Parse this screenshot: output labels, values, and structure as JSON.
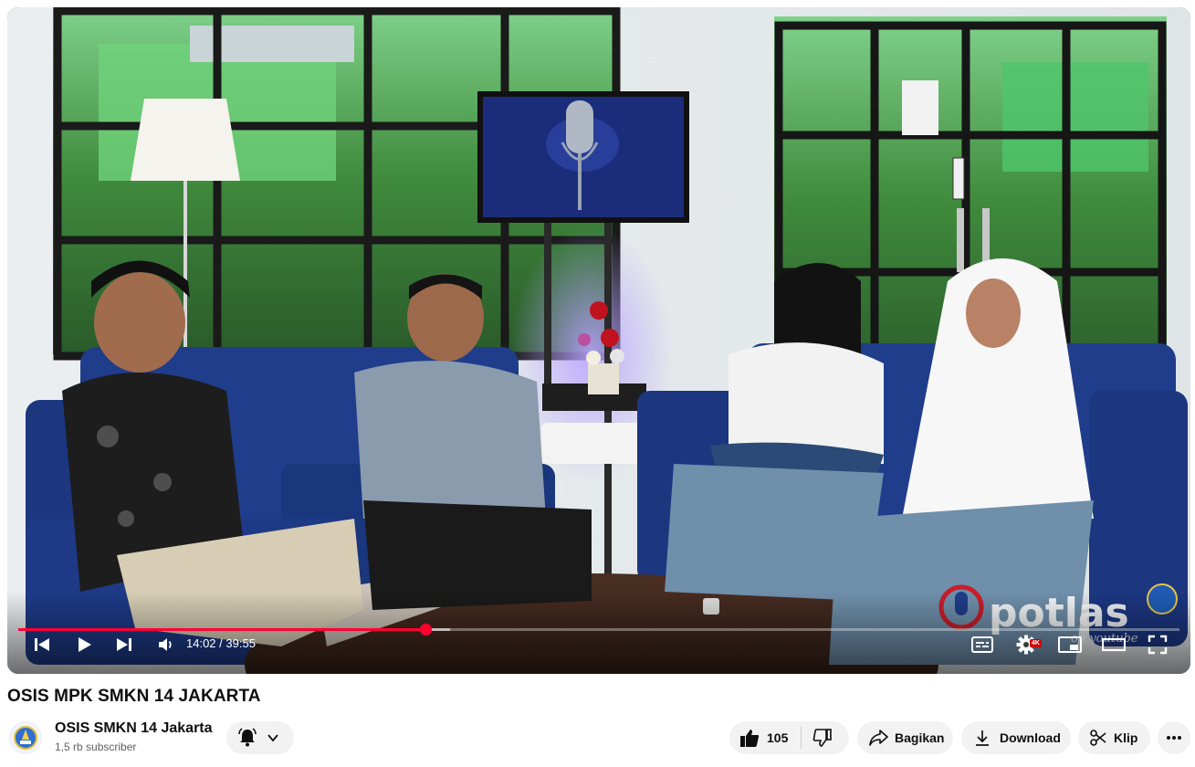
{
  "video": {
    "time_current": "14:02",
    "time_separator": " / ",
    "time_total": "39:55",
    "progress_played": 0.351,
    "progress_buffered": 0.372,
    "settings_badge": "4K",
    "watermark_text": "potlas",
    "watermark_sub": "on youtube"
  },
  "title": "OSIS MPK SMKN 14 JAKARTA",
  "channel": {
    "name": "OSIS SMKN 14 Jakarta",
    "subscribers": "1,5 rb subscriber"
  },
  "actions": {
    "like_count": "105",
    "share_label": "Bagikan",
    "download_label": "Download",
    "clip_label": "Klip"
  },
  "colors": {
    "accent": "#ff0033",
    "pill_bg": "#f2f2f2",
    "sofa": "#1f3d8a"
  }
}
